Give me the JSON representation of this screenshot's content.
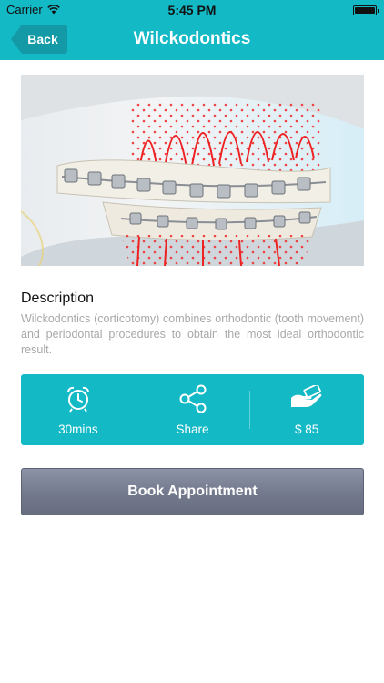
{
  "status_bar": {
    "carrier": "Carrier",
    "time": "5:45 PM"
  },
  "navbar": {
    "back_label": "Back",
    "title": "Wilckodontics",
    "color": "#14b9c6"
  },
  "description": {
    "heading": "Description",
    "text": "Wilckodontics (corticotomy) combines orthodontic (tooth movement) and periodontal procedures to obtain the most ideal orthodontic result."
  },
  "stats": [
    {
      "icon": "alarm-clock-icon",
      "label": "30mins"
    },
    {
      "icon": "share-icon",
      "label": "Share"
    },
    {
      "icon": "hand-money-icon",
      "label": "$ 85"
    }
  ],
  "book_button": {
    "label": "Book Appointment"
  }
}
